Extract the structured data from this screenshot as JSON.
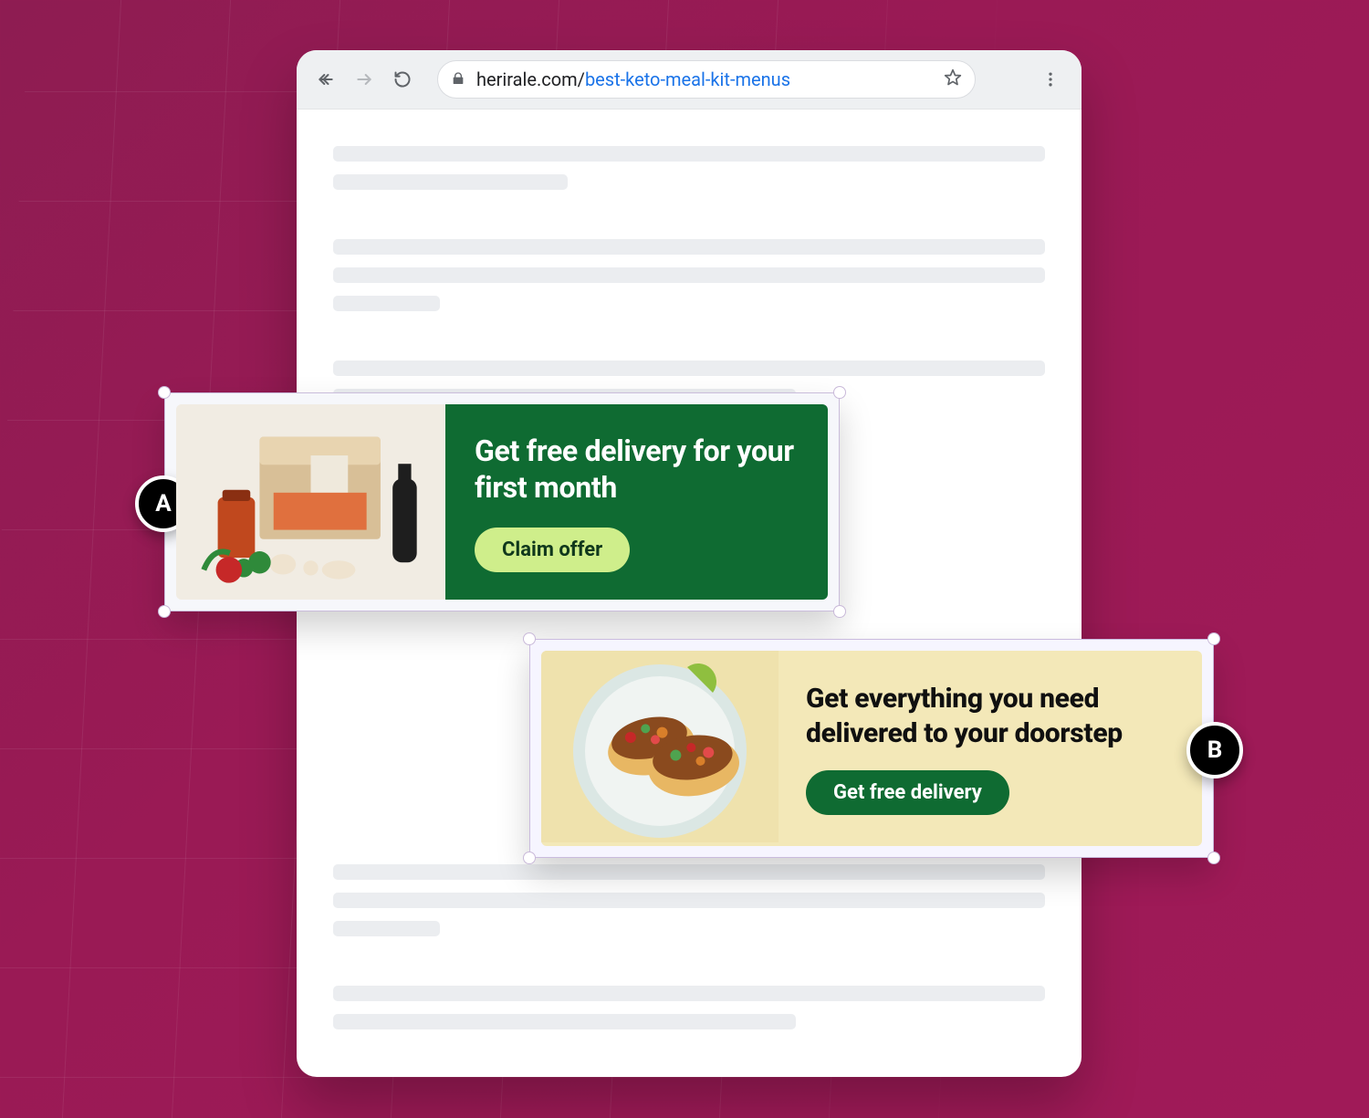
{
  "browser": {
    "url_domain": "herirale.com/",
    "url_path": "best-keto-meal-kit-menus"
  },
  "ad_a": {
    "label": "A",
    "headline": "Get free delivery for your first month",
    "cta": "Claim offer",
    "background_color": "#0f6b32",
    "cta_color": "#cfee8b",
    "image_alt": "meal-kit box with fresh produce, jar and bottle"
  },
  "ad_b": {
    "label": "B",
    "headline": "Get everything you need delivered to your doorstep",
    "cta": "Get free delivery",
    "background_color": "#f3e8b8",
    "cta_color": "#0f6b32",
    "image_alt": "plate of two tacos with salsa and lime"
  }
}
